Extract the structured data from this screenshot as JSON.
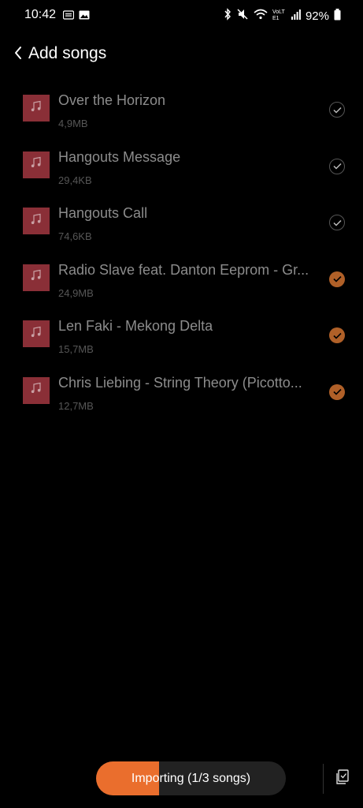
{
  "status_bar": {
    "time": "10:42",
    "battery": "92%",
    "network_label": "VoLTE1",
    "icons": [
      "sim-card-icon",
      "gallery-icon",
      "bluetooth-icon",
      "mute-icon",
      "wifi-icon",
      "signal-icon",
      "battery-icon"
    ]
  },
  "header": {
    "back_icon": "chevron-left-icon",
    "title": "Add songs"
  },
  "songs": [
    {
      "title": "Over the Horizon",
      "size": "4,9MB",
      "status": "imported"
    },
    {
      "title": "Hangouts Message",
      "size": "29,4KB",
      "status": "imported"
    },
    {
      "title": "Hangouts Call",
      "size": "74,6KB",
      "status": "imported"
    },
    {
      "title": "Radio Slave feat. Danton Eeprom - Gr...",
      "size": "24,9MB",
      "status": "selected"
    },
    {
      "title": "Len Faki - Mekong Delta",
      "size": "15,7MB",
      "status": "selected"
    },
    {
      "title": "Chris Liebing - String Theory (Picotto...",
      "size": "12,7MB",
      "status": "selected"
    }
  ],
  "import": {
    "label": "Importing (1/3 songs)",
    "progress": 0.33
  },
  "colors": {
    "accent": "#ea6e2d",
    "selected_check": "#b06028",
    "thumb": "#8a2f37"
  },
  "select_all_icon": "select-all-icon"
}
